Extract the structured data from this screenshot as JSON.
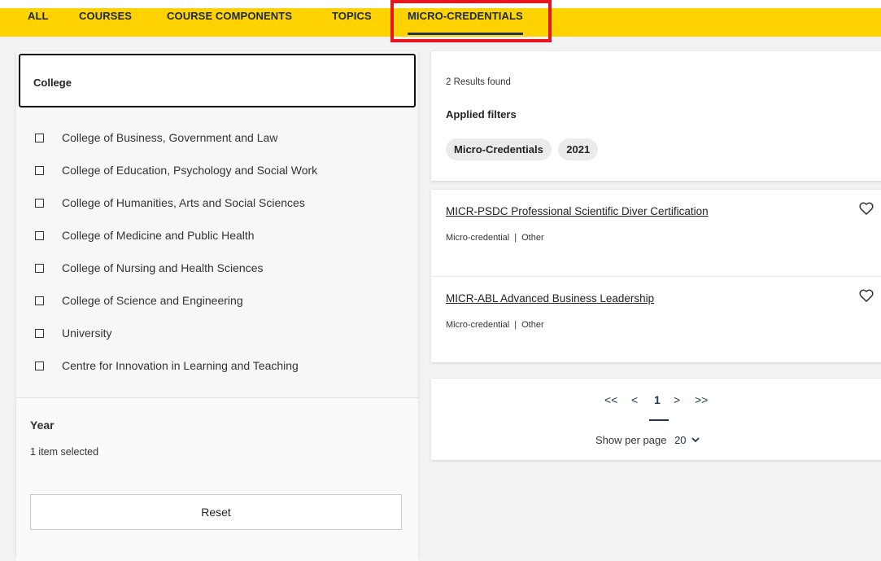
{
  "page_heading_fragment": "",
  "tabs": [
    {
      "label": "ALL"
    },
    {
      "label": "COURSES"
    },
    {
      "label": "COURSE COMPONENTS"
    },
    {
      "label": "TOPICS"
    },
    {
      "label": "MICRO-CREDENTIALS",
      "active": true
    }
  ],
  "filters": {
    "college_title": "College",
    "colleges": [
      "College of Business, Government and Law",
      "College of Education, Psychology and Social Work",
      "College of Humanities, Arts and Social Sciences",
      "College of Medicine and Public Health",
      "College of Nursing and Health Sciences",
      "College of Science and Engineering",
      "University",
      "Centre for Innovation in Learning and Teaching"
    ],
    "year_title": "Year",
    "year_summary": "1 item selected",
    "reset_label": "Reset"
  },
  "summary": {
    "results_count": "2 Results found",
    "applied_title": "Applied filters",
    "chips": [
      "Micro-Credentials",
      "2021"
    ]
  },
  "results": [
    {
      "title": "MICR-PSDC Professional Scientific Diver Certification",
      "type": "Micro-credential",
      "separator": "|",
      "category": "Other"
    },
    {
      "title": "MICR-ABL Advanced Business Leadership",
      "type": "Micro-credential",
      "separator": "|",
      "category": "Other"
    }
  ],
  "pagination": {
    "first": "<<",
    "prev": "<",
    "current": "1",
    "next": ">",
    "last": ">>",
    "per_page_label": "Show per page",
    "per_page_value": "20"
  },
  "colors": {
    "tabbar": "#ffd200",
    "highlight": "#e8141e",
    "accent": "#1d3557"
  }
}
